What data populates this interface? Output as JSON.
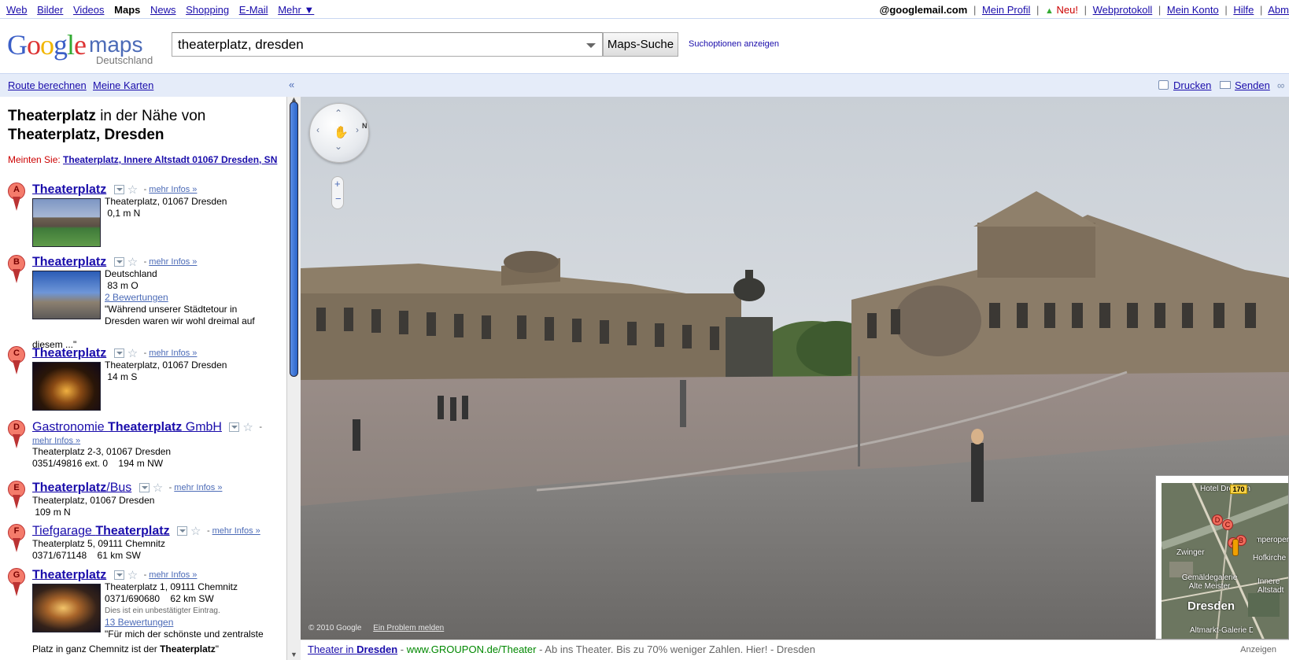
{
  "topnav": {
    "items": [
      "Web",
      "Bilder",
      "Videos",
      "Maps",
      "News",
      "Shopping",
      "E-Mail",
      "Mehr ▼"
    ],
    "active": "Maps"
  },
  "topright": {
    "email": "@googlemail.com",
    "profile": "Mein Profil",
    "neu": "Neu!",
    "webprotokoll": "Webprotokoll",
    "konto": "Mein Konto",
    "hilfe": "Hilfe",
    "abmelden": "Abm"
  },
  "logo": {
    "google": "Google",
    "maps": "maps",
    "sub": "Deutschland"
  },
  "search": {
    "value": "theaterplatz, dresden",
    "button": "Maps-Suche",
    "options": "Suchoptionen anzeigen"
  },
  "panelbar": {
    "route": "Route berechnen",
    "karten": "Meine Karten",
    "collapse": "«",
    "print": "Drucken",
    "send": "Senden"
  },
  "results": {
    "title_bold1": "Theaterplatz",
    "title_mid": " in der Nähe von",
    "title_bold2": "Theaterplatz, Dresden",
    "meinten_label": "Meinten Sie: ",
    "meinten_link": "Theaterplatz, Innere Altstadt 01067 Dresden, SN",
    "more": "mehr Infos »",
    "items": [
      {
        "letter": "A",
        "name": "Theaterplatz",
        "lines": [
          "Theaterplatz, 01067 Dresden",
          " 0,1 m N"
        ]
      },
      {
        "letter": "B",
        "name": "Theaterplatz",
        "lines": [
          "Deutschland",
          " 83 m O"
        ],
        "reviews": "2 Bewertungen",
        "quote1": "\"Während unserer Städtetour in",
        "quote2": "Dresden waren wir wohl dreimal auf",
        "quote3": "diesem ...\""
      },
      {
        "letter": "C",
        "name": "Theaterplatz",
        "lines": [
          "Theaterplatz, 01067 Dresden",
          " 14 m S"
        ]
      },
      {
        "letter": "D",
        "name_pre": "Gastronomie ",
        "name_bold": "Theaterplatz",
        "name_post": " GmbH",
        "lines": [
          "Theaterplatz 2-3, 01067 Dresden",
          "0351/49816 ext. 0    194 m NW"
        ]
      },
      {
        "letter": "E",
        "name_bold": "Theaterplatz",
        "name_post": "/Bus",
        "lines": [
          "Theaterplatz, 01067 Dresden",
          " 109 m N"
        ]
      },
      {
        "letter": "F",
        "name_pre": "Tiefgarage ",
        "name_bold": "Theaterplatz",
        "lines": [
          "Theaterplatz 5, 09111 Chemnitz",
          "0371/671148    61 km SW"
        ]
      },
      {
        "letter": "G",
        "name": "Theaterplatz",
        "lines": [
          "Theaterplatz 1, 09111 Chemnitz",
          "0371/690680    62 km SW"
        ],
        "note": "Dies ist ein unbestätigter Eintrag.",
        "reviews": "13 Bewertungen",
        "quote1": "\"Für mich der schönste und zentralste",
        "quote2": "Platz in ganz Chemnitz ist der ",
        "quote2_bold": "Theaterplatz",
        "quote2_end": "\""
      }
    ]
  },
  "streetview": {
    "compass": "N",
    "copyright": "© 2010 Google",
    "report": "Ein Problem melden"
  },
  "minimap": {
    "labels": [
      "Hotel Dresden",
      "Zwinger",
      "Semperoper",
      "Hofkirche",
      "Gemäldegalerie Alte Meister",
      "Dresden",
      "Innere Altstadt",
      "Altmarkt-Galerie Dresden"
    ],
    "shield": "170",
    "markers": [
      "D",
      "C",
      "B",
      "A"
    ]
  },
  "adbar": {
    "link1": "Theater in ",
    "link1_bold": "Dresden",
    "dash1": " - ",
    "url": "www.GROUPON.de/Theater",
    "text": " - Ab ins Theater. Bis zu 70% weniger Zahlen. Hier!",
    "loc": " - Dresden",
    "show": "Anzeigen"
  },
  "colors": {
    "link": "#1a0dab",
    "panel_bar": "#e5ecf9",
    "marker": "#f47b6b",
    "ad_green": "#008000"
  }
}
